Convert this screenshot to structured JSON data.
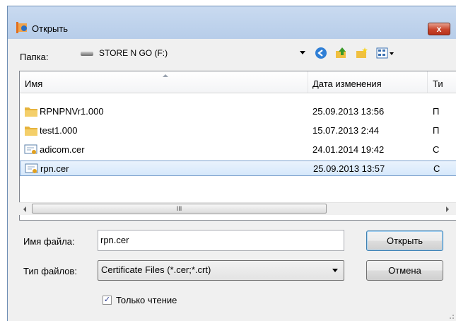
{
  "window": {
    "title": "Открыть",
    "close_glyph": "x"
  },
  "folder": {
    "label": "Папка:",
    "value": "STORE N GO (F:)",
    "icon": "drive-icon"
  },
  "toolbar": {
    "icons": [
      "back-icon",
      "up-folder-icon",
      "new-folder-icon",
      "view-menu-icon"
    ]
  },
  "list": {
    "columns": [
      "Имя",
      "Дата изменения",
      "Ти"
    ],
    "rows": [
      {
        "name": "RPNPNVr1.000",
        "date": "25.09.2013 13:56",
        "type": "П",
        "icon": "folder-icon"
      },
      {
        "name": "test1.000",
        "date": "15.07.2013 2:44",
        "type": "П",
        "icon": "folder-icon"
      },
      {
        "name": "adicom.cer",
        "date": "24.01.2014 19:42",
        "type": "С",
        "icon": "certificate-icon"
      },
      {
        "name": "rpn.cer",
        "date": "25.09.2013 13:57",
        "type": "С",
        "icon": "certificate-icon",
        "selected": true
      }
    ],
    "scroll_grip": "III"
  },
  "filename": {
    "label": "Имя файла:",
    "value": "rpn.cer"
  },
  "filetype": {
    "label": "Тип файлов:",
    "value": "Certificate Files (*.cer;*.crt)"
  },
  "buttons": {
    "open": "Открыть",
    "cancel": "Отмена"
  },
  "readonly": {
    "label": "Только чтение",
    "checked": true,
    "mark": "✓"
  }
}
